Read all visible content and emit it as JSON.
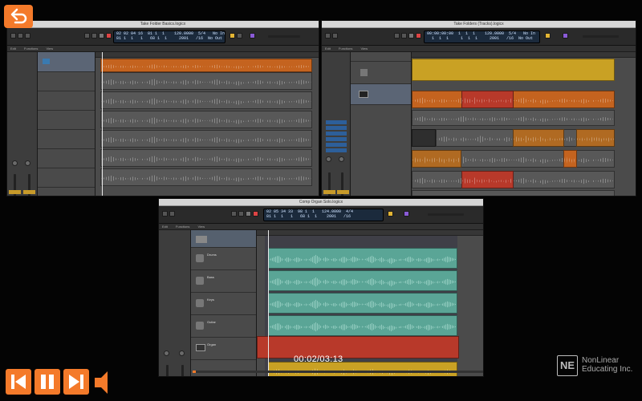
{
  "windows": {
    "left": {
      "title": "Take Folder Basics.logicx",
      "lcd_line1": "02 02 04 16  81 1  1    120.0000  5/4   No In",
      "lcd_line2": "81 1  1   1   68 1  1     2001   /16  No Out"
    },
    "right": {
      "title": "Take Folders (Tracks).logicx",
      "lcd_line1": "00:00:00:00  1  1  1    120.0000  5/4   No In",
      "lcd_line2": "  1  1  1     1  1  1     2001   /16  No Out"
    },
    "bottom": {
      "title": "Comp Organ Solo.logicx",
      "lcd_line1": "02 05 34 33  98 1  1   124.0000  4/4",
      "lcd_line2": "81 1  1   1   68 1  1    2001   /16",
      "track_labels": [
        "Drums",
        "Bass",
        "Keys",
        "Guitar",
        "Organ"
      ]
    },
    "menu_items": [
      "Edit",
      "Functions",
      "View"
    ]
  },
  "player": {
    "timecode": "00:02/03:13",
    "elapsed_fraction": 0.011
  },
  "brand": {
    "mark": "NE",
    "line1": "NonLinear",
    "line2": "Educating Inc."
  },
  "colors": {
    "accent": "#f47a2a",
    "orange_region": "#c4631f",
    "yellow_region": "#c9a124",
    "teal_region": "#5aa596",
    "red_region": "#b8392a"
  },
  "icons": [
    "exit-icon",
    "skip-back-icon",
    "pause-icon",
    "skip-forward-icon",
    "volume-icon"
  ]
}
